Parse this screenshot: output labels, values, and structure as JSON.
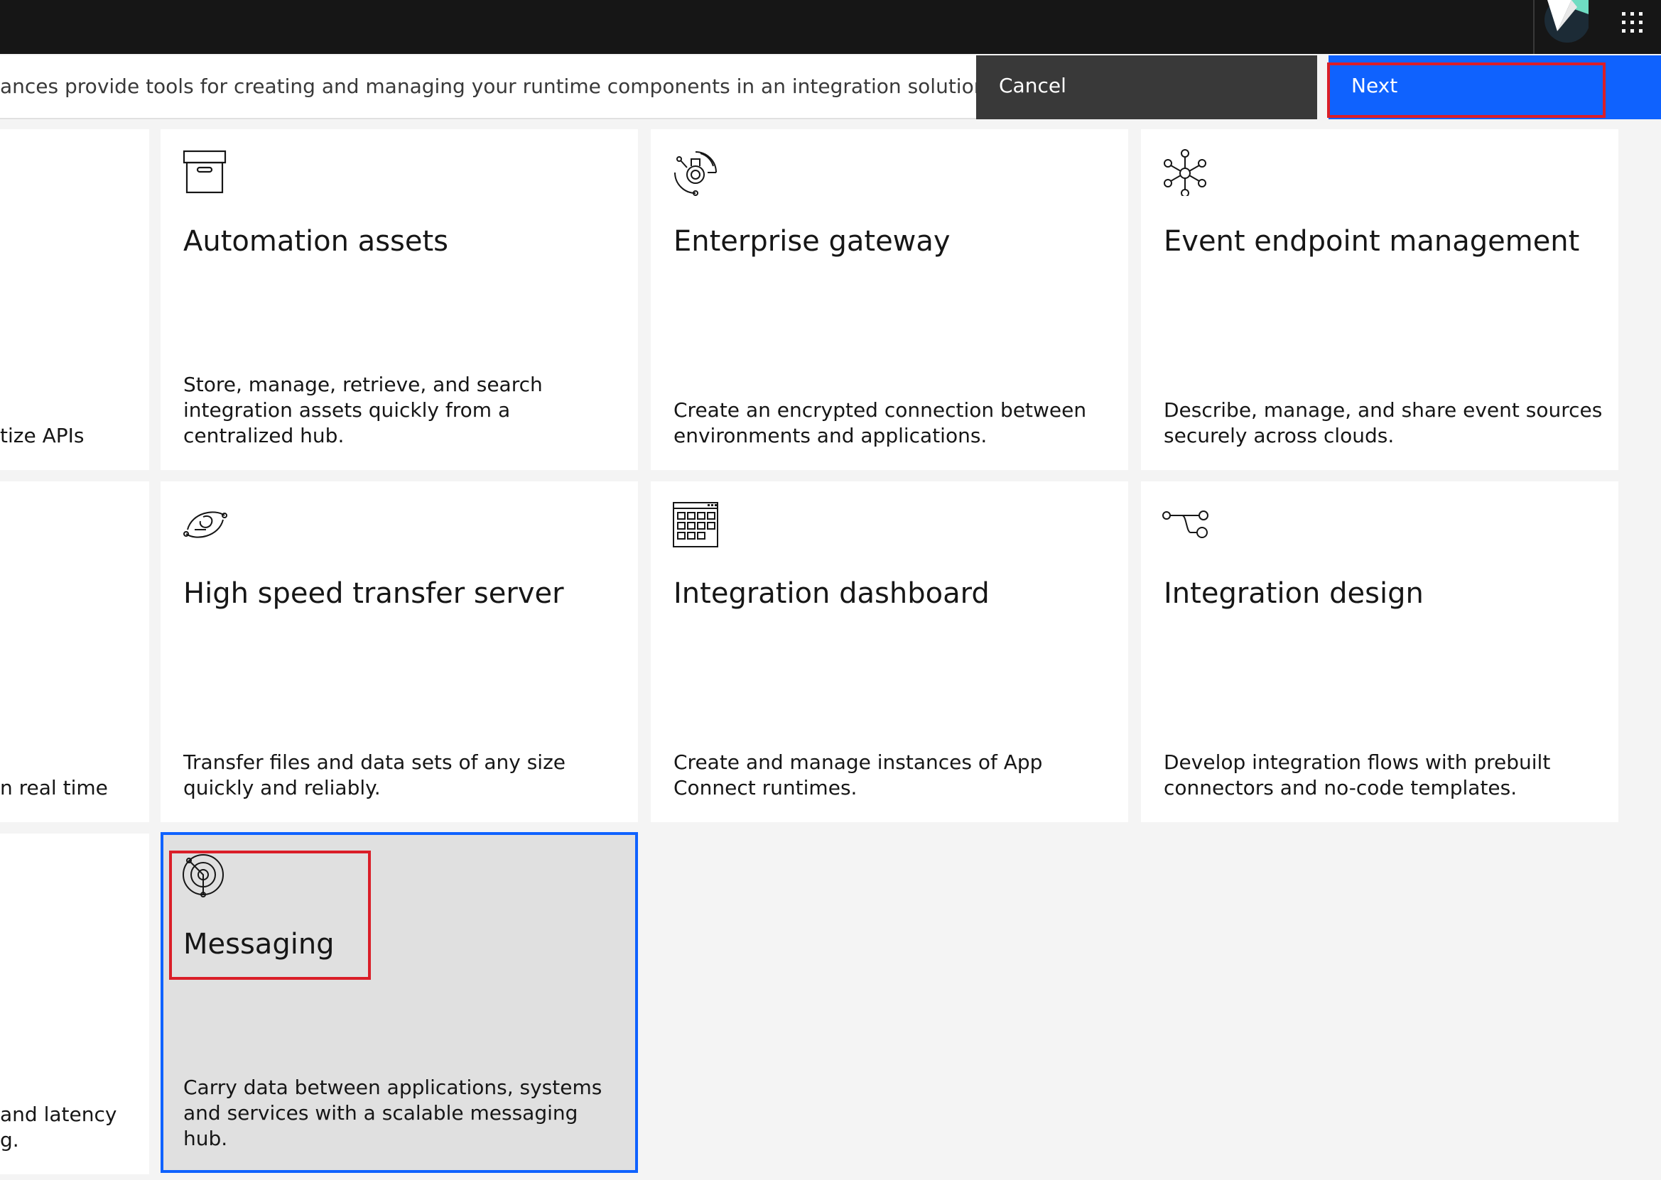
{
  "header": {
    "avatar_icon": "user-avatar-icon",
    "apps_icon": "app-switcher-grid-icon"
  },
  "actionbar": {
    "intro_text": "ances provide tools for creating and managing your runtime components in an integration solution.",
    "cancel_label": "Cancel",
    "next_label": "Next"
  },
  "tiles": {
    "partial": [
      {
        "desc_line1": "tize APIs",
        "desc_line2": ""
      },
      {
        "desc_line1": "n real time",
        "desc_line2": ""
      },
      {
        "desc_line1": " and latency",
        "desc_line2": "g."
      }
    ],
    "items": [
      {
        "title": "Automation assets",
        "icon": "archive-box-icon",
        "desc": "Store, manage, retrieve, and search integration assets quickly from a centralized hub."
      },
      {
        "title": "Enterprise gateway",
        "icon": "gateway-icon",
        "desc": "Create an encrypted connection between environments and applications."
      },
      {
        "title": "Event endpoint management",
        "icon": "event-network-icon",
        "desc": "Describe, manage, and share event sources securely across clouds."
      },
      {
        "title": "High speed transfer server",
        "icon": "transfer-icon",
        "desc": "Transfer files and data sets of any size quickly and reliably."
      },
      {
        "title": "Integration dashboard",
        "icon": "dashboard-grid-icon",
        "desc": "Create and manage instances of App Connect runtimes."
      },
      {
        "title": "Integration design",
        "icon": "flow-design-icon",
        "desc": "Develop integration flows with prebuilt connectors and no-code templates."
      },
      {
        "title": "Messaging",
        "icon": "messaging-target-icon",
        "desc": "Carry data between applications, systems and services with a scalable messaging hub."
      }
    ]
  },
  "colors": {
    "accent": "#0f62fe",
    "highlight": "#da1e28",
    "header_bg": "#161616",
    "cancel_bg": "#393939"
  }
}
